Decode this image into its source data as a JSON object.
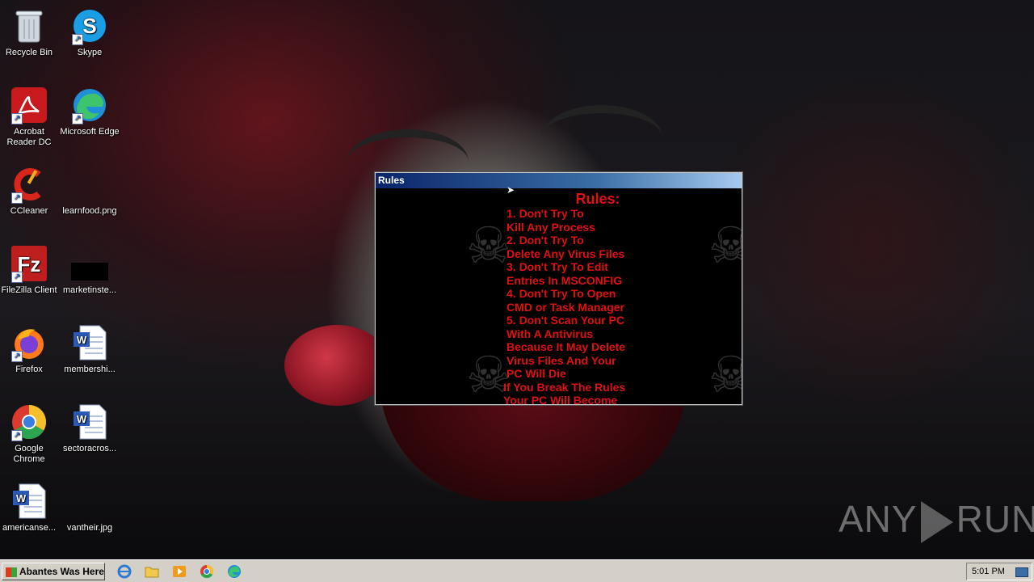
{
  "desktop": {
    "icons": [
      {
        "label": "Recycle Bin",
        "icon": "recycle-bin-icon"
      },
      {
        "label": "Skype",
        "icon": "skype-icon"
      },
      {
        "label": "Acrobat Reader DC",
        "icon": "acrobat-icon"
      },
      {
        "label": "Microsoft Edge",
        "icon": "edge-icon"
      },
      {
        "label": "CCleaner",
        "icon": "ccleaner-icon"
      },
      {
        "label": "learnfood.png",
        "icon": "image-file-icon"
      },
      {
        "label": "FileZilla Client",
        "icon": "filezilla-icon"
      },
      {
        "label": "marketinste...",
        "icon": "image-file-icon"
      },
      {
        "label": "Firefox",
        "icon": "firefox-icon"
      },
      {
        "label": "membershi...",
        "icon": "word-document-icon"
      },
      {
        "label": "Google Chrome",
        "icon": "chrome-icon"
      },
      {
        "label": "sectoracros...",
        "icon": "word-document-icon"
      },
      {
        "label": "americanse...",
        "icon": "word-document-icon"
      },
      {
        "label": "vantheir.jpg",
        "icon": "image-file-icon"
      }
    ]
  },
  "rules_window": {
    "title": "Rules",
    "heading": "Rules:",
    "lines": [
      " 1. Don't Try To",
      "Kill Any Process",
      "2. Don't Try To",
      "Delete Any Virus Files",
      " 3. Don't Try To Edit",
      "Entries In MSCONFIG",
      "4. Don't Try To Open",
      "CMD or Task Manager",
      "5. Don't Scan Your PC",
      "With A Antivirus",
      "Because It May Delete",
      "Virus Files And Your",
      "PC Will Die",
      "If You Break The Rules",
      "Your PC Will Become"
    ],
    "text_color": "#e01010"
  },
  "taskbar": {
    "start_label": "Abantes Was Here",
    "quick_launch": [
      "internet-explorer-icon",
      "folder-icon",
      "media-player-icon",
      "chrome-icon",
      "edge-icon"
    ],
    "clock": "5:01 PM"
  },
  "watermark": {
    "left": "ANY",
    "right": "RUN"
  }
}
